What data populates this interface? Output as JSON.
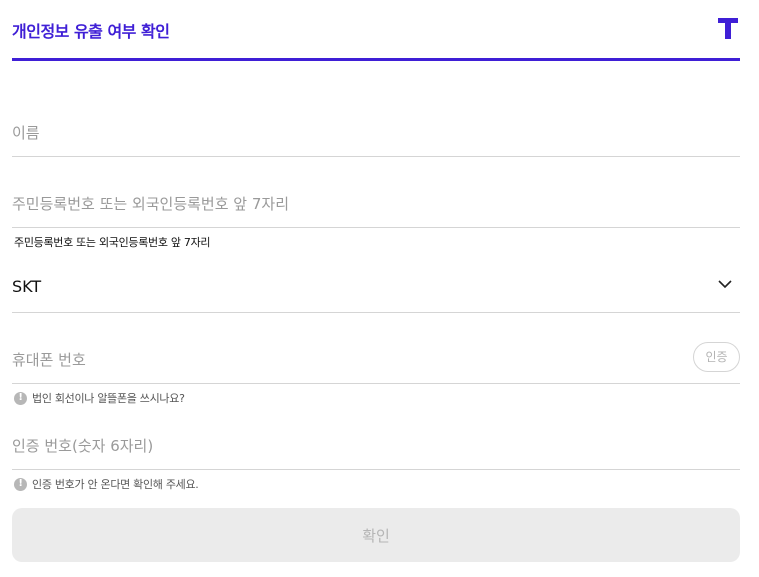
{
  "header": {
    "title": "개인정보 유출 여부 확인",
    "logo_icon": "t-logo-icon",
    "accent_color": "#3f1fd6"
  },
  "form": {
    "name": {
      "placeholder": "이름",
      "value": ""
    },
    "rrn": {
      "placeholder": "주민등록번호 또는 외국인등록번호 앞 7자리",
      "value": "",
      "hint": "주민등록번호 또는 외국인등록번호 앞 7자리"
    },
    "carrier": {
      "selected": "SKT",
      "icon": "chevron-down-icon"
    },
    "phone": {
      "placeholder": "휴대폰 번호",
      "value": "",
      "verify_label": "인증",
      "hint": "법인 회선이나 알뜰폰을 쓰시나요?",
      "hint_icon": "info-icon"
    },
    "code": {
      "placeholder": "인증 번호(숫자 6자리)",
      "value": "",
      "hint": "인증 번호가 안 온다면 확인해 주세요.",
      "hint_icon": "info-icon"
    }
  },
  "submit": {
    "label": "확인"
  }
}
